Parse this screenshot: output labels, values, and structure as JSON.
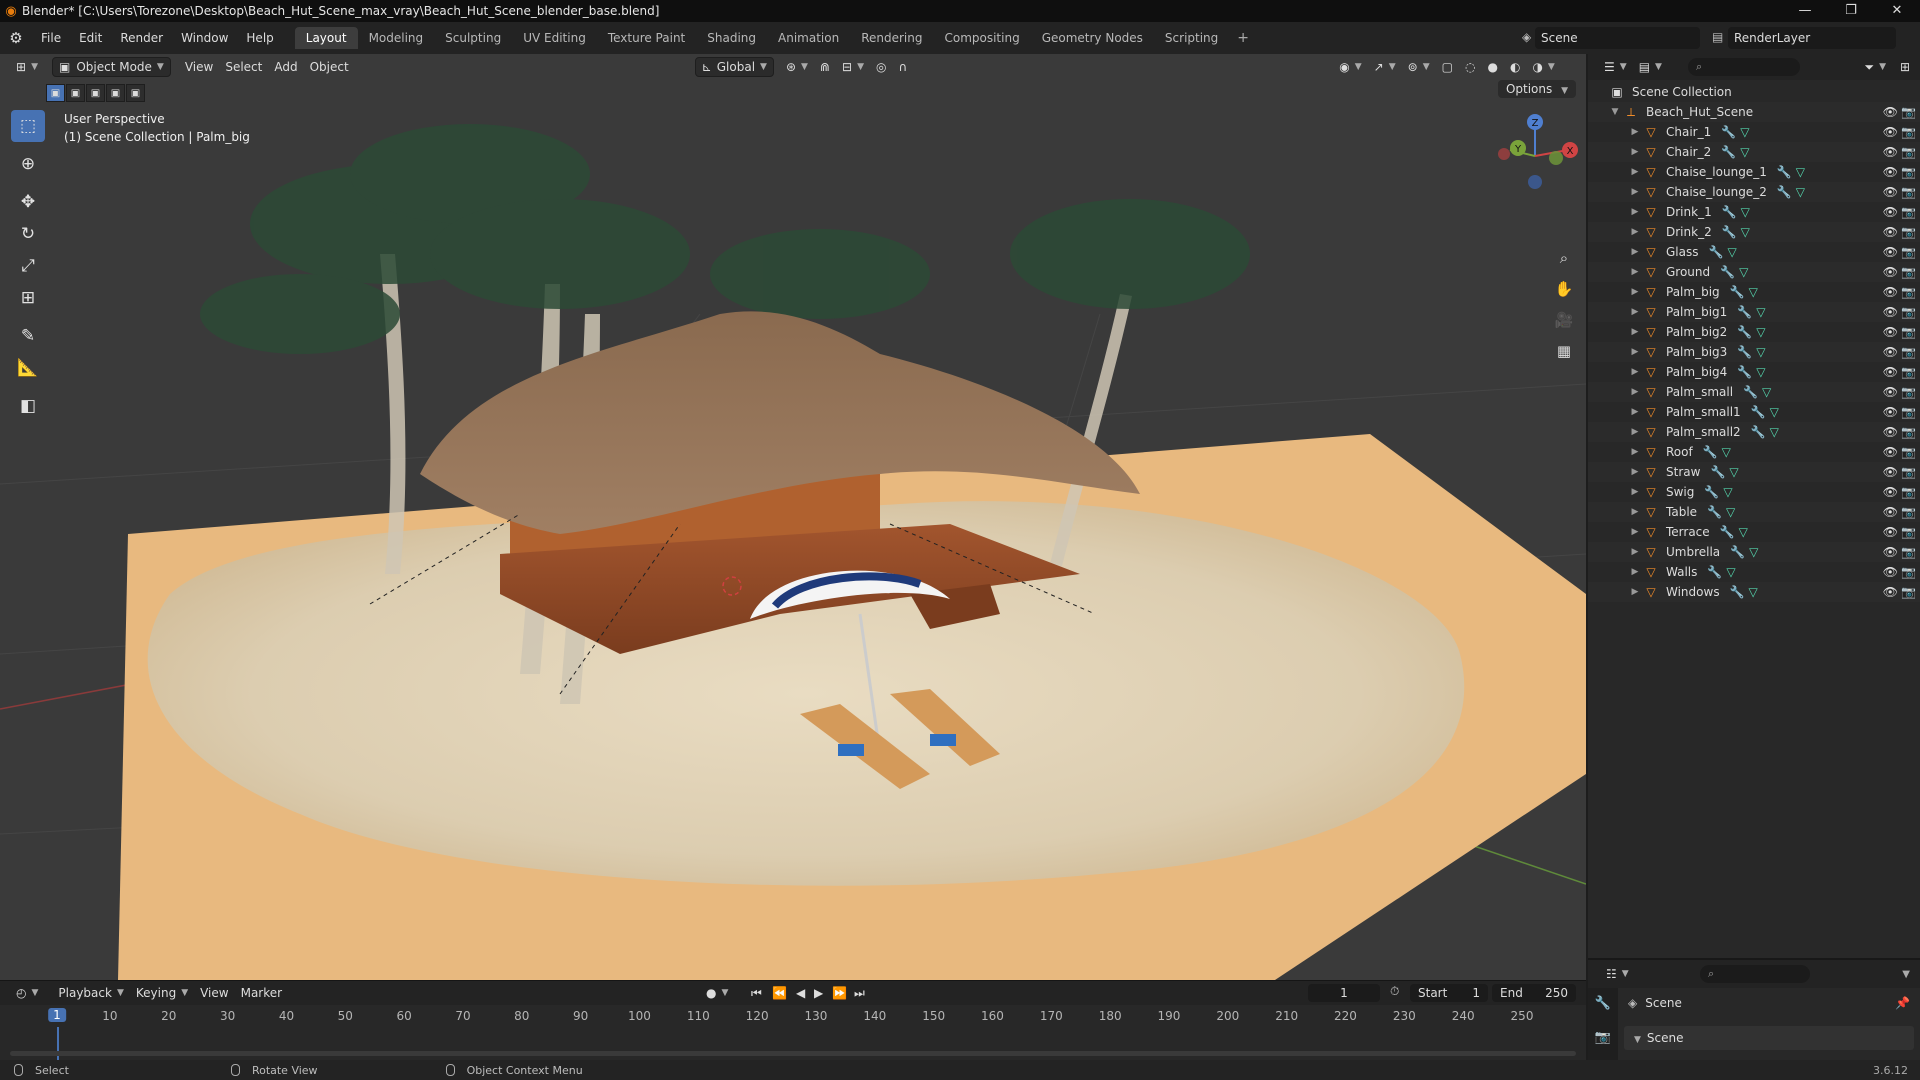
{
  "titlebar": {
    "title": "Blender* [C:\\Users\\Torezone\\Desktop\\Beach_Hut_Scene_max_vray\\Beach_Hut_Scene_blender_base.blend]",
    "minimize": "—",
    "maximize": "❐",
    "close": "✕"
  },
  "menu": {
    "items": [
      "File",
      "Edit",
      "Render",
      "Window",
      "Help"
    ]
  },
  "workspaces": {
    "tabs": [
      "Layout",
      "Modeling",
      "Sculpting",
      "UV Editing",
      "Texture Paint",
      "Shading",
      "Animation",
      "Rendering",
      "Compositing",
      "Geometry Nodes",
      "Scripting"
    ],
    "active": "Layout",
    "add": "+"
  },
  "scene_selector": {
    "value": "Scene"
  },
  "view_layer": {
    "value": "RenderLayer"
  },
  "viewport_header": {
    "mode": "Object Mode",
    "menus": [
      "View",
      "Select",
      "Add",
      "Object"
    ],
    "orientation": "Global",
    "options": "Options"
  },
  "viewport_info": {
    "line1": "User Perspective",
    "line2": "(1) Scene Collection | Palm_big"
  },
  "gizmo": {
    "z": "Z",
    "y": "Y",
    "x": "X"
  },
  "outliner": {
    "search_placeholder": "",
    "collection": "Scene Collection",
    "root": "Beach_Hut_Scene",
    "objects": [
      "Chair_1",
      "Chair_2",
      "Chaise_lounge_1",
      "Chaise_lounge_2",
      "Drink_1",
      "Drink_2",
      "Glass",
      "Ground",
      "Palm_big",
      "Palm_big1",
      "Palm_big2",
      "Palm_big3",
      "Palm_big4",
      "Palm_small",
      "Palm_small1",
      "Palm_small2",
      "Roof",
      "Straw",
      "Swig",
      "Table",
      "Terrace",
      "Umbrella",
      "Walls",
      "Windows"
    ]
  },
  "properties": {
    "breadcrumb": "Scene",
    "panel": "Scene"
  },
  "timeline": {
    "menus": [
      "Playback",
      "Keying",
      "View",
      "Marker"
    ],
    "current_frame": "1",
    "start_label": "Start",
    "start": "1",
    "end_label": "End",
    "end": "250",
    "ticks": [
      "1",
      "10",
      "20",
      "30",
      "40",
      "50",
      "60",
      "70",
      "80",
      "90",
      "100",
      "110",
      "120",
      "130",
      "140",
      "150",
      "160",
      "170",
      "180",
      "190",
      "200",
      "210",
      "220",
      "230",
      "240",
      "250"
    ]
  },
  "statusbar": {
    "select": "Select",
    "rotate": "Rotate View",
    "context": "Object Context Menu",
    "version": "3.6.12"
  },
  "colors": {
    "accent": "#4772b3",
    "object_icon": "#f08c2a",
    "modifier_icon": "#7aa4ff",
    "mesh_icon": "#55d6ae"
  }
}
